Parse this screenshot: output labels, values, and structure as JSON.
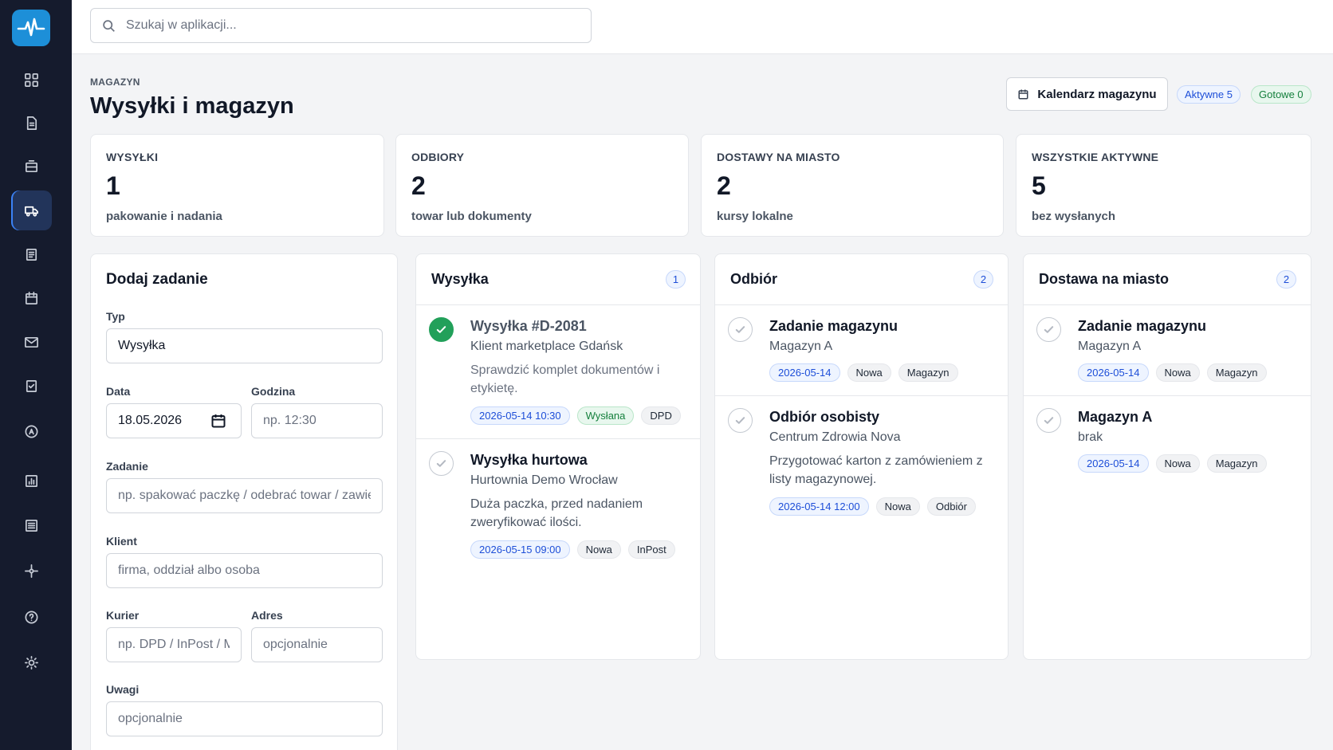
{
  "search": {
    "placeholder": "Szukaj w aplikacji..."
  },
  "header": {
    "eyebrow": "MAGAZYN",
    "title": "Wysyłki i magazyn",
    "calendar_button": "Kalendarz magazynu",
    "badge_active": "Aktywne 5",
    "badge_done": "Gotowe 0"
  },
  "stats": [
    {
      "label": "WYSYŁKI",
      "value": "1",
      "sub": "pakowanie i nadania"
    },
    {
      "label": "ODBIORY",
      "value": "2",
      "sub": "towar lub dokumenty"
    },
    {
      "label": "DOSTAWY NA MIASTO",
      "value": "2",
      "sub": "kursy lokalne"
    },
    {
      "label": "WSZYSTKIE AKTYWNE",
      "value": "5",
      "sub": "bez wysłanych"
    }
  ],
  "form": {
    "title": "Dodaj zadanie",
    "type_label": "Typ",
    "type_value": "Wysyłka",
    "date_label": "Data",
    "date_value": "18.05.2026",
    "time_label": "Godzina",
    "time_placeholder": "np. 12:30",
    "task_label": "Zadanie",
    "task_placeholder": "np. spakować paczkę / odebrać towar / zawieźć",
    "client_label": "Klient",
    "client_placeholder": "firma, oddział albo osoba",
    "courier_label": "Kurier",
    "courier_placeholder": "np. DPD / InPost / M",
    "address_label": "Adres",
    "address_placeholder": "opcjonalnie",
    "notes_label": "Uwagi",
    "notes_placeholder": "opcjonalnie"
  },
  "columns": [
    {
      "title": "Wysyłka",
      "count": "1",
      "tasks": [
        {
          "title": "Wysyłka #D-2081",
          "sub": "Klient marketplace Gdańsk",
          "note": "Sprawdzić komplet dokumentów i etykietę.",
          "date": "2026-05-14 10:30",
          "status": "Wysłana",
          "extra": "DPD"
        },
        {
          "title": "Wysyłka hurtowa",
          "sub": "Hurtownia Demo Wrocław",
          "note": "Duża paczka, przed nadaniem zweryfikować ilości.",
          "date": "2026-05-15 09:00",
          "status": "Nowa",
          "extra": "InPost"
        }
      ]
    },
    {
      "title": "Odbiór",
      "count": "2",
      "tasks": [
        {
          "title": "Zadanie magazynu",
          "sub": "Magazyn A",
          "date": "2026-05-14",
          "status": "Nowa",
          "extra": "Magazyn"
        },
        {
          "title": "Odbiór osobisty",
          "sub": "Centrum Zdrowia Nova",
          "note": "Przygotować karton z zamówieniem z listy magazynowej.",
          "date": "2026-05-14 12:00",
          "status": "Nowa",
          "extra": "Odbiór"
        }
      ]
    },
    {
      "title": "Dostawa na miasto",
      "count": "2",
      "tasks": [
        {
          "title": "Zadanie magazynu",
          "sub": "Magazyn A",
          "date": "2026-05-14",
          "status": "Nowa",
          "extra": "Magazyn"
        },
        {
          "title": "Magazyn A",
          "sub": "brak",
          "date": "2026-05-14",
          "status": "Nowa",
          "extra": "Magazyn"
        }
      ]
    }
  ]
}
